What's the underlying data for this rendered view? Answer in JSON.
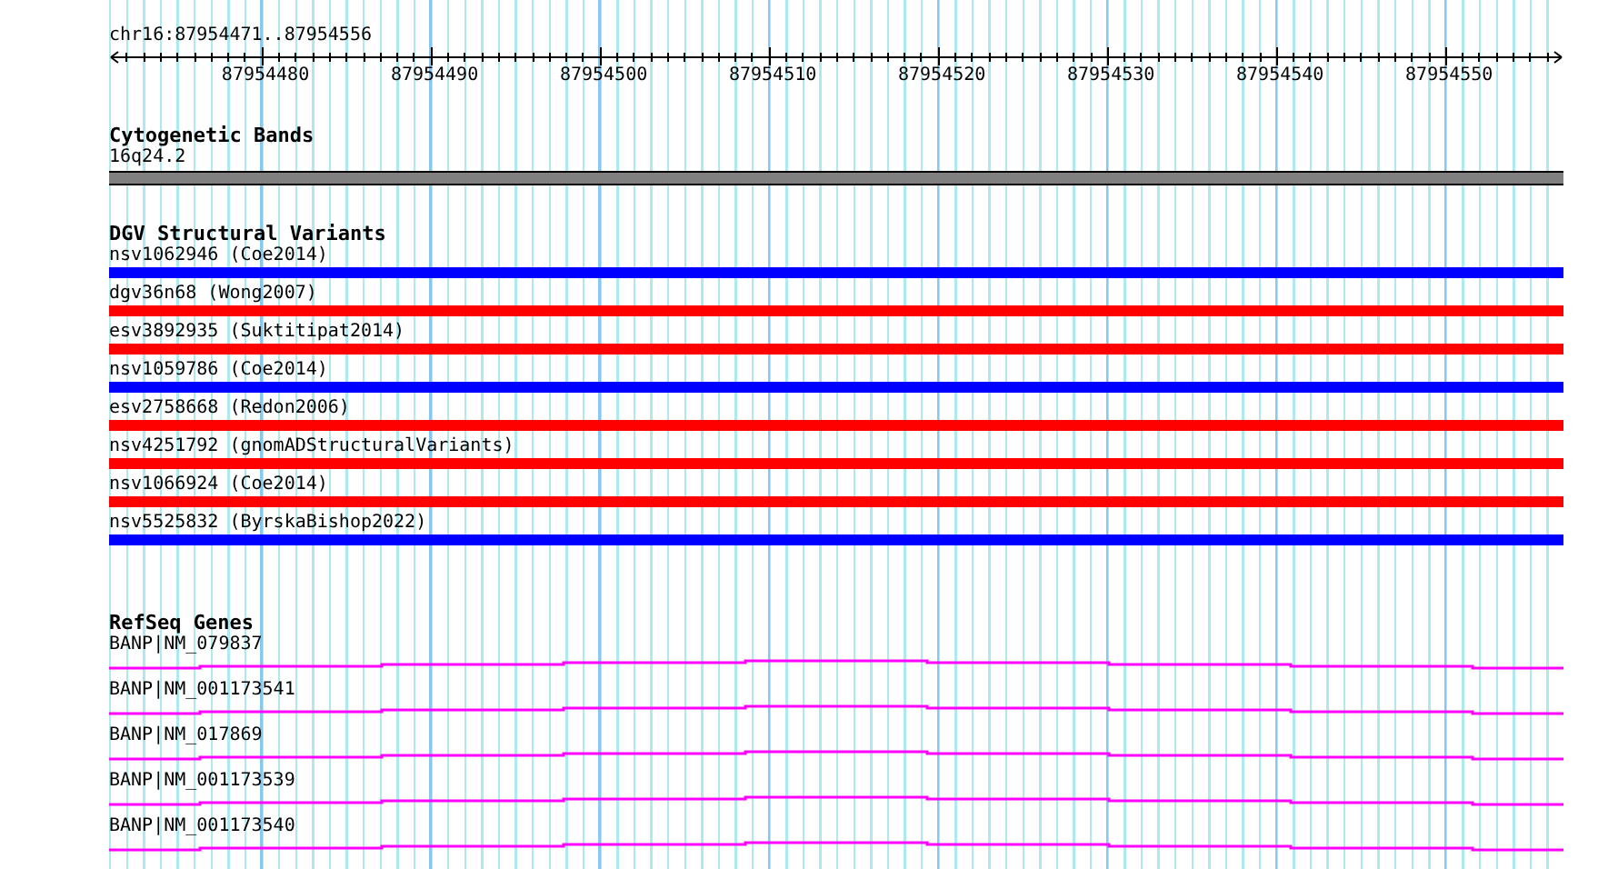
{
  "ruler": {
    "location": "chr16:87954471..87954556",
    "ticks": [
      "87954480",
      "87954490",
      "87954500",
      "87954510",
      "87954520",
      "87954530",
      "87954540",
      "87954550"
    ]
  },
  "tracks": [
    {
      "kind": "cytoband",
      "title": "Cytogenetic Bands",
      "features": [
        {
          "label": "16q24.2",
          "color": "#808080"
        }
      ]
    },
    {
      "kind": "variants",
      "title": "DGV Structural Variants",
      "features": [
        {
          "label": "nsv1062946 (Coe2014)",
          "color": "#0000ff"
        },
        {
          "label": "dgv36n68 (Wong2007)",
          "color": "#ff0000"
        },
        {
          "label": "esv3892935 (Suktitipat2014)",
          "color": "#ff0000"
        },
        {
          "label": "nsv1059786 (Coe2014)",
          "color": "#0000ff"
        },
        {
          "label": "esv2758668 (Redon2006)",
          "color": "#ff0000"
        },
        {
          "label": "nsv4251792 (gnomADStructuralVariants)",
          "color": "#ff0000"
        },
        {
          "label": "nsv1066924 (Coe2014)",
          "color": "#ff0000"
        },
        {
          "label": "nsv5525832 (ByrskaBishop2022)",
          "color": "#0000ff"
        }
      ]
    },
    {
      "kind": "genes",
      "title": "RefSeq Genes",
      "features": [
        {
          "label": "BANP|NM_079837"
        },
        {
          "label": "BANP|NM_001173541"
        },
        {
          "label": "BANP|NM_017869"
        },
        {
          "label": "BANP|NM_001173539"
        },
        {
          "label": "BANP|NM_001173540"
        }
      ]
    }
  ]
}
